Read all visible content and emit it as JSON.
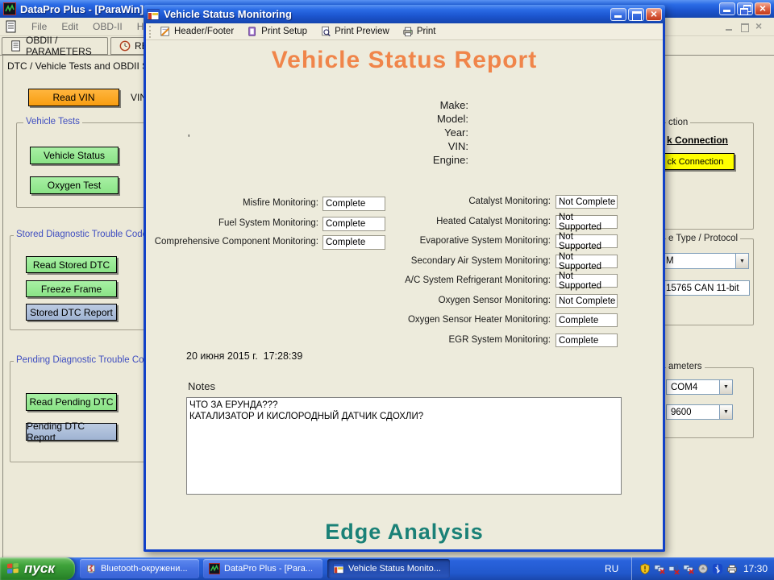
{
  "colors": {
    "window-face": "#ece9d8",
    "report-bg": "#edebdc",
    "accent-orange": "#f0854a",
    "accent-teal": "#1a8177",
    "group-label-blue": "#3f4ec0",
    "field-border": "#7f9db9"
  },
  "main_window": {
    "title": "DataPro Plus - [ParaWin]",
    "menu_items": [
      "File",
      "Edit",
      "OBD-II",
      "Help"
    ],
    "tabs": [
      {
        "label": "OBDII / PARAMETERS"
      },
      {
        "label": "RE"
      }
    ],
    "panel_header": "DTC / Vehicle Tests and OBDII Setup",
    "read_vin_button": "Read VIN",
    "vin_label": "VIN",
    "vehicle_tests_group": {
      "title": "Vehicle Tests",
      "vehicle_status_button": "Vehicle Status",
      "oxygen_test_button": "Oxygen Test"
    },
    "stored_group": {
      "title": "Stored Diagnostic Trouble Codes (",
      "read_stored_button": "Read Stored DTC",
      "freeze_frame_button": "Freeze Frame",
      "stored_report_button": "Stored DTC Report"
    },
    "pending_group": {
      "title": "Pending Diagnostic Trouble Codes",
      "read_pending_button": "Read Pending DTC",
      "pending_report_button": "Pending DTC Report"
    },
    "right_panel": {
      "connection_group_title": "ction",
      "connection_link": "k Connection",
      "connection_button": "ck Connection",
      "protocol_group_title": "e Type / Protocol",
      "protocol_select_value": "M",
      "protocol_field_value": "15765 CAN 11-bit",
      "params_group_title": "ameters",
      "com_port_value": "COM4",
      "baud_value": "9600"
    }
  },
  "dialog": {
    "title": "Vehicle Status Monitoring",
    "toolbar": {
      "header_footer": "Header/Footer",
      "print_setup": "Print Setup",
      "print_preview": "Print Preview",
      "print": "Print"
    },
    "report": {
      "title": "Vehicle Status Report",
      "stray_mark": "'",
      "vehicle_fields": [
        {
          "label": "Make:"
        },
        {
          "label": "Model:"
        },
        {
          "label": "Year:"
        },
        {
          "label": "VIN:"
        },
        {
          "label": "Engine:"
        }
      ],
      "left_monitors": [
        {
          "label": "Misfire Monitoring:",
          "value": "Complete"
        },
        {
          "label": "Fuel System Monitoring:",
          "value": "Complete"
        },
        {
          "label": "Comprehensive  Component  Monitoring:",
          "value": "Complete"
        }
      ],
      "right_monitors": [
        {
          "label": "Catalyst Monitoring:",
          "value": "Not Complete"
        },
        {
          "label": "Heated Catalyst Monitoring:",
          "value": "Not Supported"
        },
        {
          "label": "Evaporative System Monitoring:",
          "value": "Not Supported"
        },
        {
          "label": "Secondary Air System Monitoring:",
          "value": "Not Supported"
        },
        {
          "label": "A/C System Refrigerant Monitoring:",
          "value": "Not Supported"
        },
        {
          "label": "Oxygen Sensor Monitoring:",
          "value": "Not Complete"
        },
        {
          "label": "Oxygen Sensor Heater Monitoring:",
          "value": "Complete"
        },
        {
          "label": "EGR System Monitoring:",
          "value": "Complete"
        }
      ],
      "timestamp": "20 июня 2015 г.  17:28:39",
      "notes_label": "Notes",
      "notes_text": "ЧТО ЗА ЕРУНДА???\nКАТАЛИЗАТОР И КИСЛОРОДНЫЙ ДАТЧИК СДОХЛИ?",
      "footer": "Edge Analysis"
    }
  },
  "taskbar": {
    "start_label": "пуск",
    "items": [
      {
        "label": "Bluetooth-окружени..."
      },
      {
        "label": "DataPro Plus - [Para..."
      },
      {
        "label": "Vehicle Status Monito..."
      }
    ],
    "language": "RU",
    "time": "17:30"
  }
}
